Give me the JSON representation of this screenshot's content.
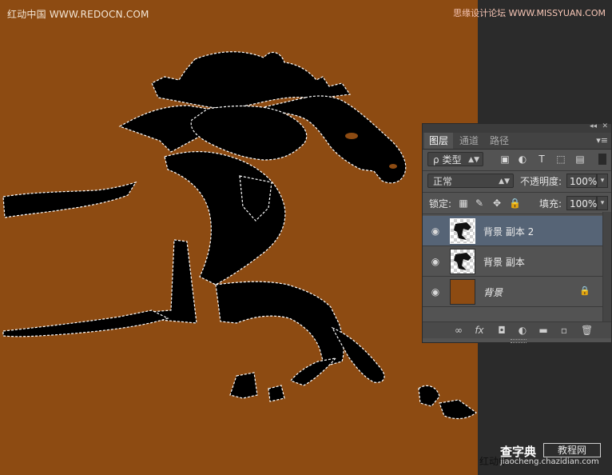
{
  "canvas": {
    "background_color": "#8d4b12",
    "silhouette_color": "#000000",
    "watermark_top_left": "红动中国 WWW.REDOCN.COM",
    "watermark_top_right": "思缘设计论坛 WWW.MISSYUAN.COM",
    "watermark_bottom": "红动中",
    "logo_main": "查字典",
    "logo_box": "教程网",
    "logo_url": "jiaocheng.chazidian.com"
  },
  "layers_panel": {
    "collapse_glyph": "◂◂",
    "close_glyph": "✕",
    "tabs": [
      {
        "label": "图层",
        "active": true
      },
      {
        "label": "通道",
        "active": false
      },
      {
        "label": "路径",
        "active": false
      }
    ],
    "menu_glyph": "▾≡",
    "filter": {
      "search_glyph": "ρ",
      "kind_label": "类型"
    },
    "filter_icons": [
      "image-filter-icon",
      "adjustment-filter-icon",
      "type-filter-icon",
      "shape-filter-icon",
      "smart-object-filter-icon"
    ],
    "blend_mode": "正常",
    "opacity_label": "不透明度:",
    "opacity_value": "100%",
    "lock_label": "锁定:",
    "fill_label": "填充:",
    "fill_value": "100%",
    "layers": [
      {
        "name": "背景 副本 2",
        "visible": true,
        "selected": true,
        "thumbnail": "transparent-horse",
        "locked": false,
        "italic": false
      },
      {
        "name": "背景 副本",
        "visible": true,
        "selected": false,
        "thumbnail": "transparent-horse",
        "locked": false,
        "italic": false
      },
      {
        "name": "背景",
        "visible": true,
        "selected": false,
        "thumbnail": "solid-brown",
        "locked": true,
        "italic": true
      }
    ],
    "bottom_icons": [
      "link-layers-icon",
      "fx-icon",
      "add-mask-icon",
      "adjustment-layer-icon",
      "new-group-icon",
      "new-layer-icon",
      "delete-layer-icon"
    ]
  }
}
